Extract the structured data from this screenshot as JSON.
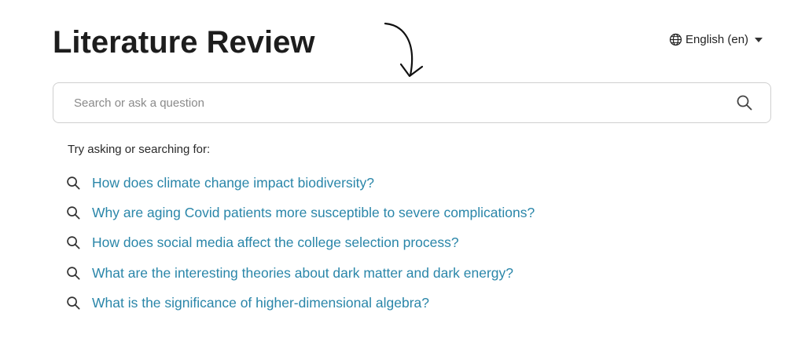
{
  "header": {
    "title": "Literature Review",
    "language": {
      "label": "English (en)",
      "icon": "globe-icon",
      "caret_icon": "caret-down-icon"
    }
  },
  "search": {
    "placeholder": "Search or ask a question",
    "value": "",
    "icon": "search-icon"
  },
  "suggestions": {
    "label": "Try asking or searching for:",
    "accent_color": "#2a86a9",
    "items": [
      {
        "label": "How does climate change impact biodiversity?",
        "icon": "search-icon"
      },
      {
        "label": "Why are aging Covid patients more susceptible to severe complications?",
        "icon": "search-icon"
      },
      {
        "label": "How does social media affect the college selection process?",
        "icon": "search-icon"
      },
      {
        "label": "What are the interesting theories about dark matter and dark energy?",
        "icon": "search-icon"
      },
      {
        "label": "What is the significance of higher-dimensional algebra?",
        "icon": "search-icon"
      }
    ]
  },
  "annotation": {
    "icon": "hand-drawn-arrow-icon"
  }
}
